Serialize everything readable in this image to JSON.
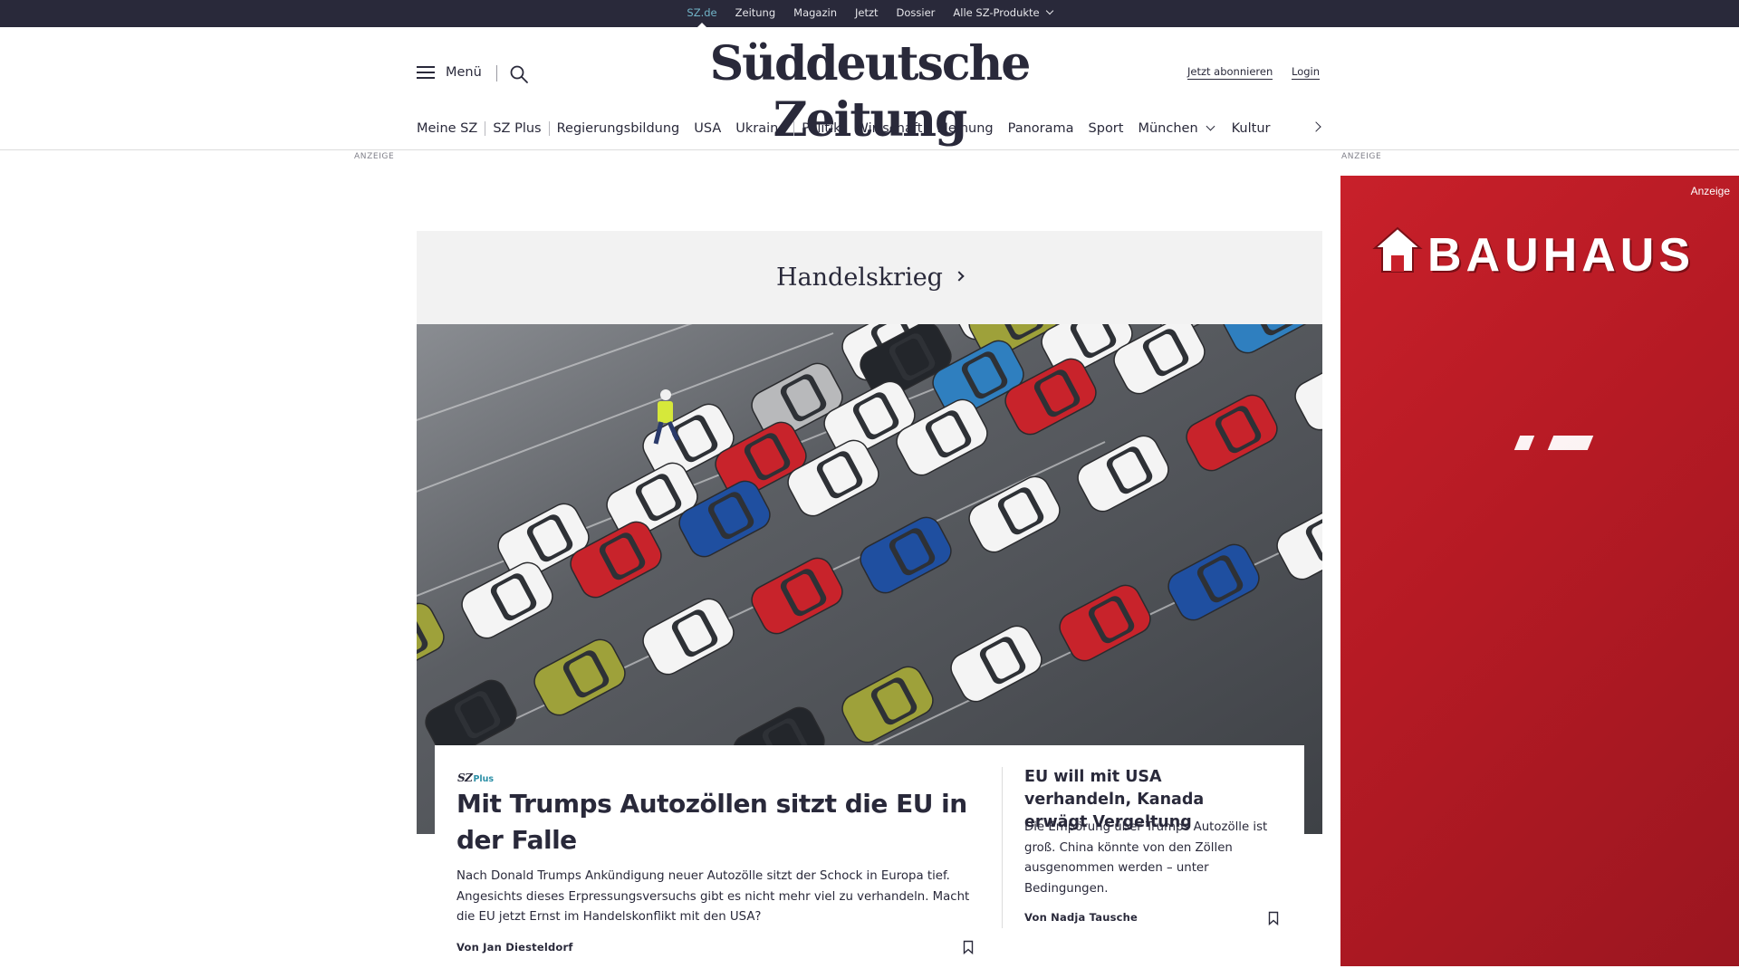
{
  "topbar": {
    "links": [
      "SZ.de",
      "Zeitung",
      "Magazin",
      "Jetzt",
      "Dossier",
      "Alle SZ-Produkte"
    ],
    "active": "SZ.de"
  },
  "header": {
    "menu_label": "Menü",
    "logo": "Süddeutsche Zeitung",
    "subscribe_label": "Jetzt abonnieren",
    "login_label": "Login"
  },
  "nav": {
    "group1": [
      "Meine SZ",
      "SZ Plus"
    ],
    "group2": [
      "Regierungsbildung",
      "USA",
      "Ukraine"
    ],
    "group3": [
      "Politik",
      "Wirtschaft",
      "Meinung",
      "Panorama",
      "Sport",
      "München",
      "Kultur"
    ]
  },
  "ads": {
    "left_label": "ANZEIGE",
    "right_label": "ANZEIGE",
    "banner_tag": "Anzeige",
    "banner_brand": "BAUHAUS"
  },
  "topic": {
    "title": "Handelskrieg"
  },
  "lead": {
    "badge_sz": "SZ",
    "badge_plus": "Plus",
    "headline": "Mit Trumps Autozöllen sitzt die EU in der Falle",
    "text": "Nach Donald Trumps Ankündigung neuer Autozölle sitzt der Schock in Europa tief. Angesichts dieses Erpressungsversuchs gibt es nicht mehr viel zu verhandeln. Macht die EU jetzt Ernst im Handelskonflikt mit den USA?",
    "author": "Von Jan Diesteldorf"
  },
  "side": {
    "headline": "EU will mit USA verhandeln, Kanada erwägt Vergeltung",
    "text": "Die Empörung über Trumps Autozölle ist groß. China könnte von den Zöllen ausgenommen werden – unter Bedingungen.",
    "author": "Von Nadja Tausche"
  },
  "colors": {
    "topbar": "#29293a",
    "accent_blue": "#71b4c8",
    "plus_teal": "#2b8fa6",
    "ad_red": "#c8202a"
  }
}
